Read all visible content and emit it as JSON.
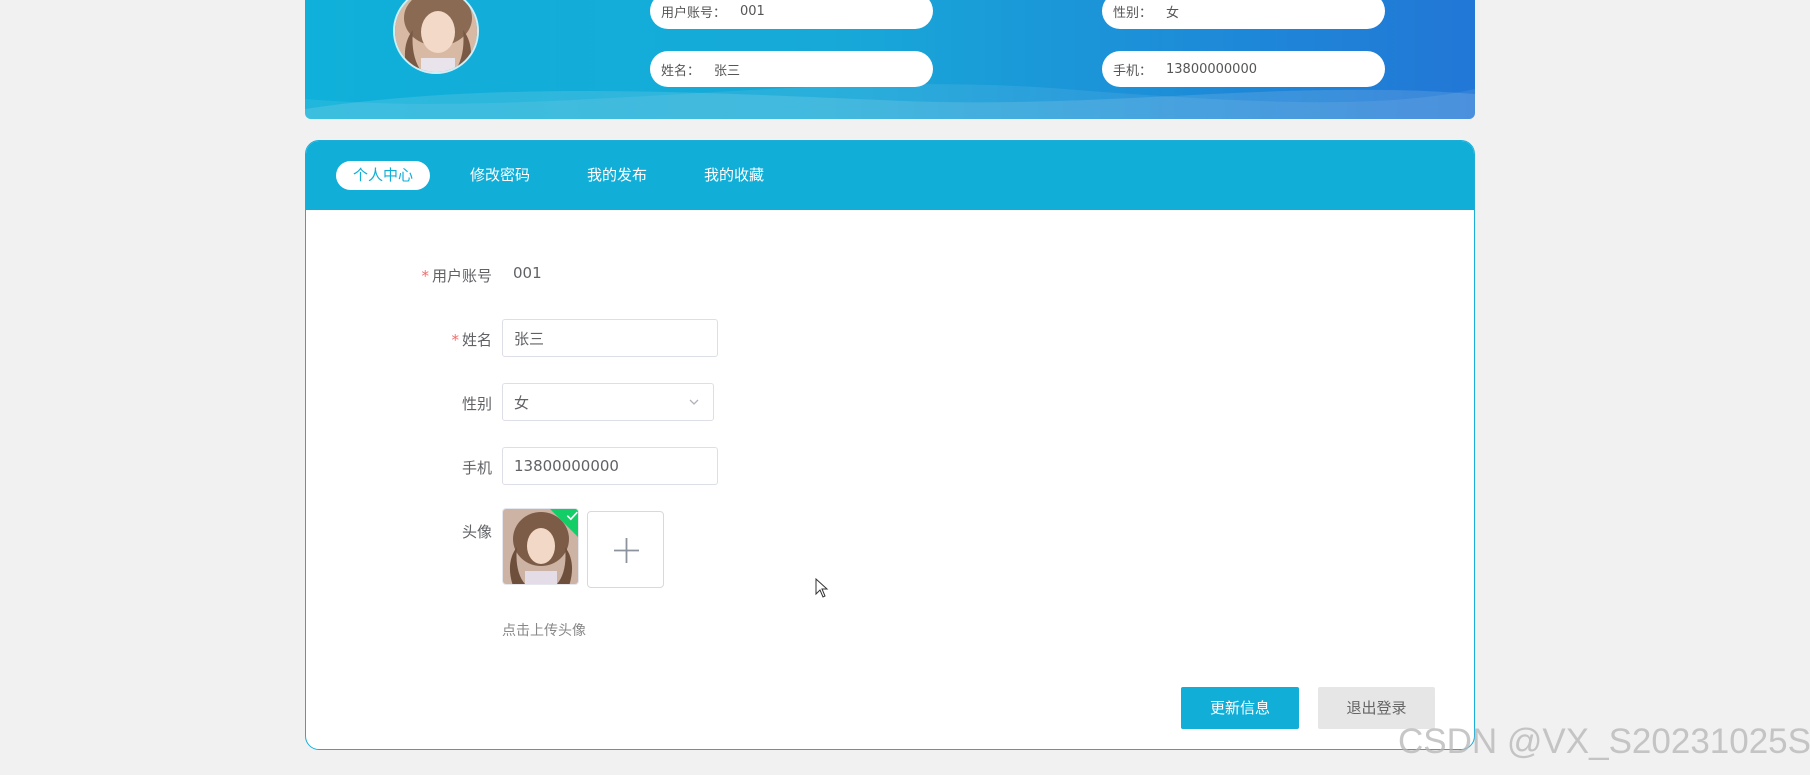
{
  "header": {
    "account_label": "用户账号：",
    "account_value": "001",
    "gender_label": "性别：",
    "gender_value": "女",
    "name_label": "姓名：",
    "name_value": "张三",
    "phone_label": "手机：",
    "phone_value": "13800000000"
  },
  "tabs": [
    {
      "label": "个人中心",
      "active": true
    },
    {
      "label": "修改密码",
      "active": false
    },
    {
      "label": "我的发布",
      "active": false
    },
    {
      "label": "我的收藏",
      "active": false
    }
  ],
  "form": {
    "account": {
      "label": "用户账号",
      "required": true,
      "value": "001"
    },
    "name": {
      "label": "姓名",
      "required": true,
      "value": "张三"
    },
    "gender": {
      "label": "性别",
      "value": "女",
      "icon": "chevron-down-icon"
    },
    "phone": {
      "label": "手机",
      "value": "13800000000"
    },
    "avatar": {
      "label": "头像",
      "hint": "点击上传头像",
      "uploaded_icon": "check-icon",
      "add_icon": "plus-icon"
    }
  },
  "buttons": {
    "update": "更新信息",
    "logout": "退出登录"
  },
  "watermark": "CSDN @VX_S20231025S",
  "colors": {
    "primary": "#11aed8",
    "required": "#f56c6c",
    "success": "#13ce66",
    "gray_button": "#e6e6e6"
  }
}
